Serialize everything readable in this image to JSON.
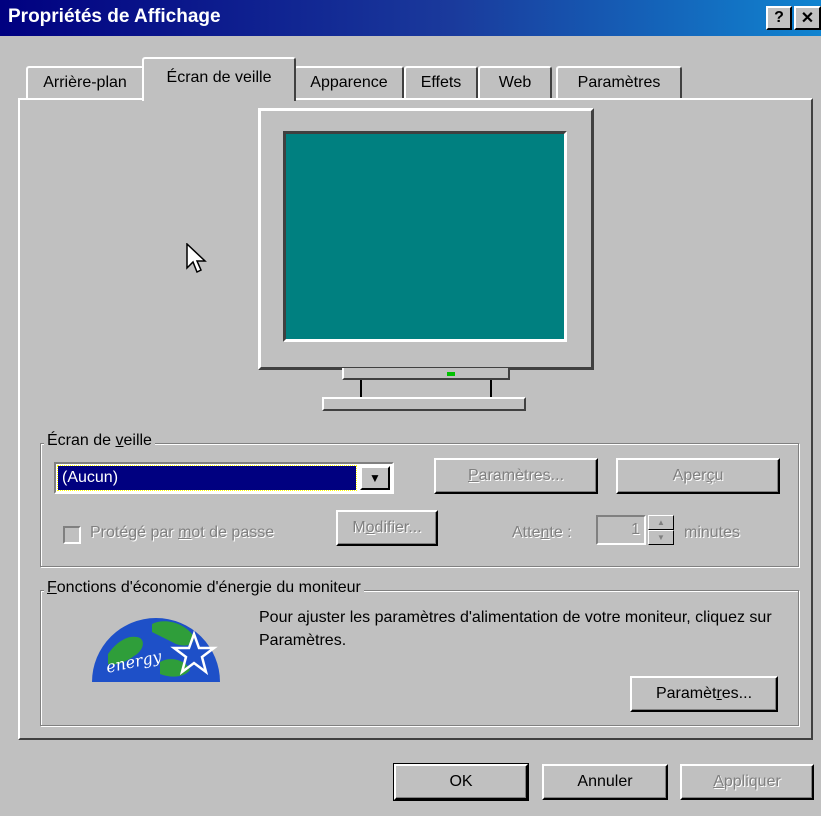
{
  "window": {
    "title": "Propriétés de Affichage",
    "help_button": "?",
    "close_button": "✕"
  },
  "tabs": [
    {
      "label": "Arrière-plan",
      "active": false
    },
    {
      "label": "Écran de veille",
      "active": true
    },
    {
      "label": "Apparence",
      "active": false
    },
    {
      "label": "Effets",
      "active": false
    },
    {
      "label": "Web",
      "active": false
    },
    {
      "label": "Paramètres",
      "active": false
    }
  ],
  "preview": {
    "screen_color": "#008080"
  },
  "screensaver": {
    "group_label_pre": "Écran de ",
    "group_label_acc": "v",
    "group_label_post": "eille",
    "selected": "(Aucun)",
    "settings_button_acc": "P",
    "settings_button_post": "aramètres...",
    "preview_button_pre": "Aper",
    "preview_button_acc": "ç",
    "preview_button_post": "u",
    "password_label_pre": "Protégé par ",
    "password_label_acc": "m",
    "password_label_post": "ot de passe",
    "modify_button_pre": "M",
    "modify_button_acc": "o",
    "modify_button_post": "difier...",
    "wait_label_pre": "Atte",
    "wait_label_acc": "n",
    "wait_label_post": "te :",
    "wait_value": "1",
    "minutes_label": "minutes"
  },
  "energy": {
    "group_label_acc": "F",
    "group_label_post": "onctions d'économie d'énergie du moniteur",
    "description": "Pour ajuster les paramètres d'alimentation de votre moniteur, cliquez sur Paramètres.",
    "logo_text": "energy",
    "settings_button_pre": "Paramèt",
    "settings_button_acc": "r",
    "settings_button_post": "es..."
  },
  "footer": {
    "ok": "OK",
    "cancel": "Annuler",
    "apply_acc": "A",
    "apply_post": "ppliquer"
  },
  "colors": {
    "title_bar": "#000080",
    "face": "#c0c0c0",
    "selection": "#000080"
  }
}
